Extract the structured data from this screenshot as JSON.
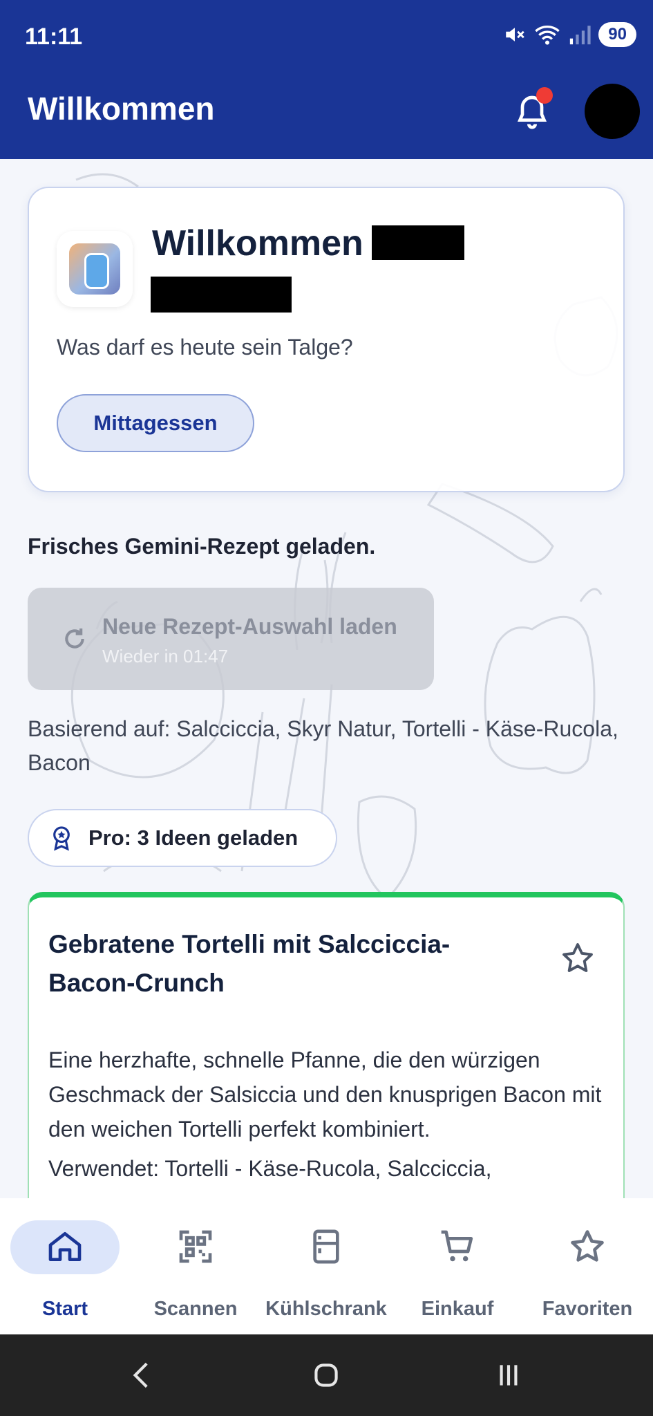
{
  "status_bar": {
    "time": "11:11",
    "battery": "90"
  },
  "app_bar": {
    "title": "Willkommen"
  },
  "welcome_card": {
    "title": "Willkommen",
    "question": "Was darf es heute sein Talge?",
    "meal_chip": "Mittagessen"
  },
  "recipe_status": "Frisches Gemini-Rezept geladen.",
  "reload_button": {
    "title": "Neue Rezept-Auswahl laden",
    "subtitle": "Wieder in 01:47"
  },
  "based_on": "Basierend auf: Salcciccia, Skyr Natur, Tortelli - Käse-Rucola, Bacon",
  "pro_chip": {
    "label": "Pro: 3 Ideen geladen"
  },
  "recipe": {
    "title": "Gebratene Tortelli mit Salcciccia-Bacon-Crunch",
    "description": "Eine herzhafte, schnelle Pfanne, die den würzigen Geschmack der Salsiccia und den knusprigen Bacon mit den weichen Tortelli perfekt kombiniert.",
    "used": "Verwendet: Tortelli - Käse-Rucola, Salcciccia,"
  },
  "bottom_nav": {
    "items": [
      {
        "label": "Start",
        "icon": "home-icon",
        "active": true
      },
      {
        "label": "Scannen",
        "icon": "qr-scan-icon"
      },
      {
        "label": "Kühlschrank",
        "icon": "fridge-icon"
      },
      {
        "label": "Einkauf",
        "icon": "cart-icon"
      },
      {
        "label": "Favoriten",
        "icon": "star-icon"
      }
    ]
  },
  "colors": {
    "primary": "#1a3596",
    "accent_green": "#22c55e",
    "notification": "#ef3b35"
  }
}
